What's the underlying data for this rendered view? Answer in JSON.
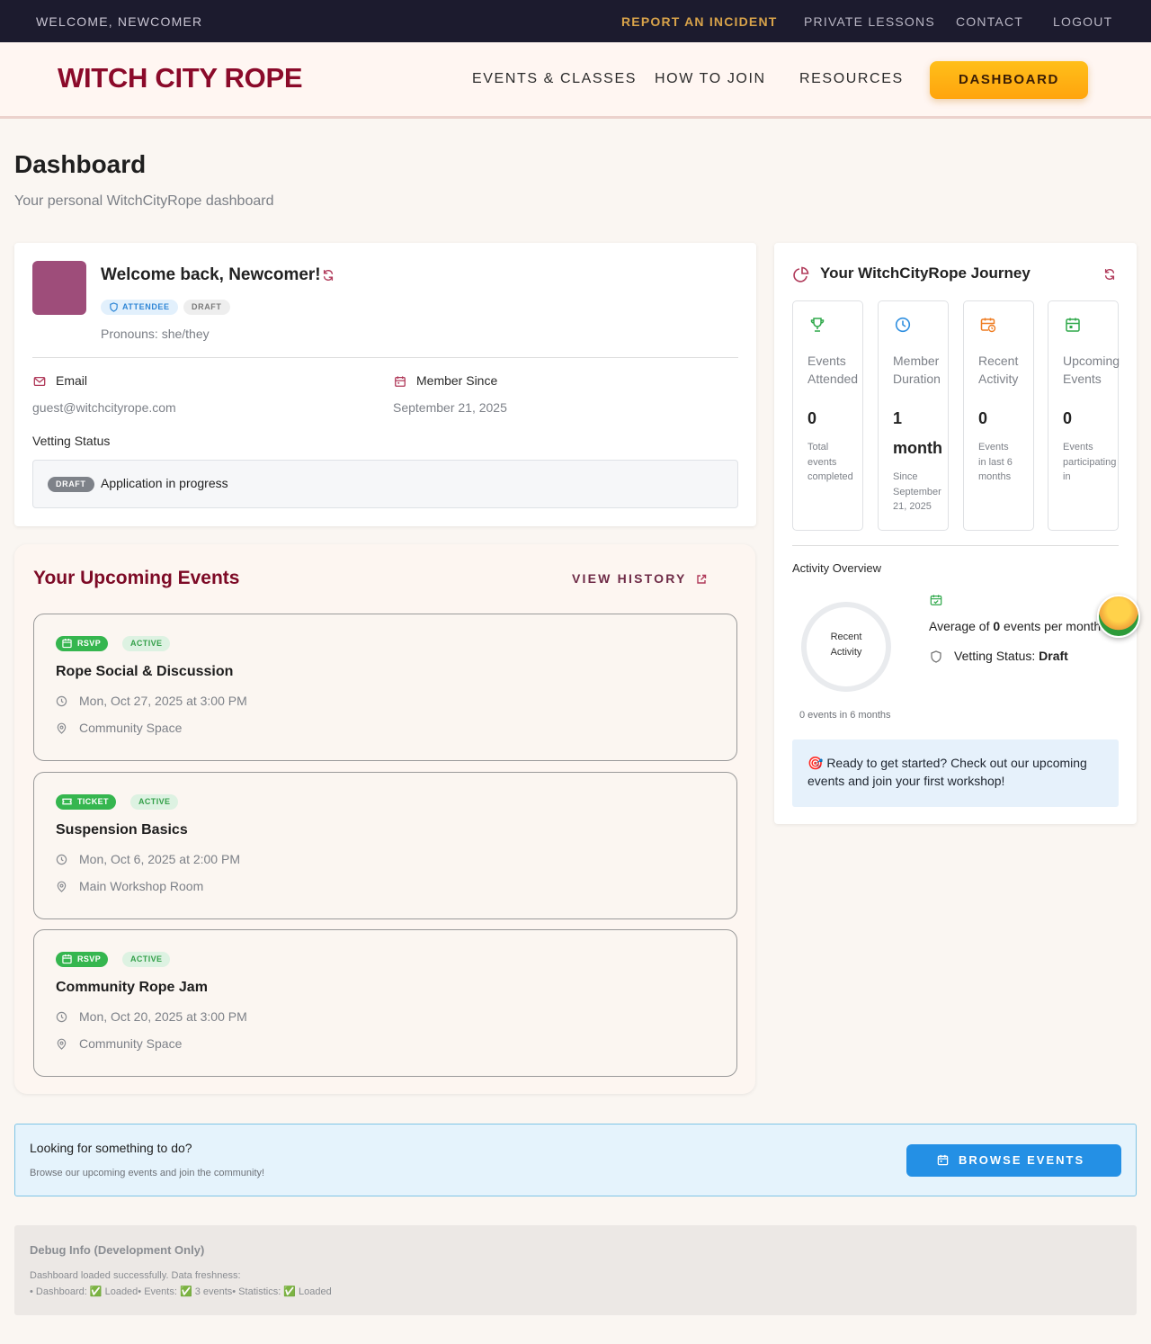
{
  "utility": {
    "welcome": "WELCOME, NEWCOMER",
    "links": [
      "REPORT AN INCIDENT",
      "PRIVATE LESSONS",
      "CONTACT",
      "LOGOUT"
    ]
  },
  "header": {
    "logo": "WITCH CITY ROPE",
    "nav": [
      "EVENTS & CLASSES",
      "HOW TO JOIN",
      "RESOURCES"
    ],
    "cta": "DASHBOARD"
  },
  "page": {
    "title": "Dashboard",
    "subtitle": "Your personal WitchCityRope dashboard"
  },
  "profile": {
    "welcome": "Welcome back, Newcomer!",
    "role_badge": "ATTENDEE",
    "status_badge": "DRAFT",
    "pronouns": "Pronouns: she/they",
    "email_label": "Email",
    "email_value": "guest@witchcityrope.com",
    "member_since_label": "Member Since",
    "member_since_value": "September 21, 2025",
    "vetting_label": "Vetting Status",
    "vetting_chip": "DRAFT",
    "vetting_text": "Application in progress"
  },
  "events": {
    "title": "Your Upcoming Events",
    "view_history": "VIEW HISTORY",
    "items": [
      {
        "type": "RSVP",
        "status": "ACTIVE",
        "title": "Rope Social & Discussion",
        "when": "Mon, Oct 27, 2025 at 3:00 PM",
        "where": "Community Space"
      },
      {
        "type": "TICKET",
        "status": "ACTIVE",
        "title": "Suspension Basics",
        "when": "Mon, Oct 6, 2025 at 2:00 PM",
        "where": "Main Workshop Room"
      },
      {
        "type": "RSVP",
        "status": "ACTIVE",
        "title": "Community Rope Jam",
        "when": "Mon, Oct 20, 2025 at 3:00 PM",
        "where": "Community Space"
      }
    ]
  },
  "journey": {
    "title": "Your WitchCityRope Journey",
    "stats": [
      {
        "label_1": "Events",
        "label_2": "Attended",
        "value": "0",
        "desc": [
          "Total",
          "events",
          "completed"
        ],
        "icon": "trophy-icon",
        "color": "#2fa84a"
      },
      {
        "label_1": "Member",
        "label_2": "Duration",
        "value_1": "1",
        "value_2": "month",
        "desc": [
          "Since",
          "September",
          "21, 2025"
        ],
        "icon": "clock-icon",
        "color": "#2f8fe0"
      },
      {
        "label_1": "Recent",
        "label_2": "Activity",
        "value": "0",
        "desc": [
          "Events",
          "in last 6",
          "months"
        ],
        "icon": "calendar-clock-icon",
        "color": "#ef7d22"
      },
      {
        "label_1": "Upcoming",
        "label_2": "Events",
        "value": "0",
        "desc": [
          "Events",
          "participating",
          "in"
        ],
        "icon": "calendar-icon",
        "color": "#2fa84a"
      }
    ],
    "activity_title": "Activity Overview",
    "ring_line_1": "Recent",
    "ring_line_2": "Activity",
    "ring_caption": "0 events in 6 months",
    "avg_prefix": "Average of ",
    "avg_value": "0",
    "avg_suffix": " events per month",
    "vetting_prefix": "Vetting Status: ",
    "vetting_value": "Draft",
    "ready_text": "🎯 Ready to get started? Check out our upcoming events and join your first workshop!"
  },
  "browse": {
    "question": "Looking for something to do?",
    "sub": "Browse our upcoming events and join the community!",
    "button": "BROWSE EVENTS"
  },
  "debug": {
    "title": "Debug Info (Development Only)",
    "line1": "Dashboard loaded successfully. Data freshness:",
    "line2": "• Dashboard: ✅ Loaded• Events: ✅ 3 events• Statistics: ✅ Loaded"
  },
  "colors": {
    "brand": "#8b0a2a",
    "accent": "#ffb215",
    "utility_bg": "#1c1b2e",
    "success": "#35b64f",
    "info": "#2490e5"
  }
}
